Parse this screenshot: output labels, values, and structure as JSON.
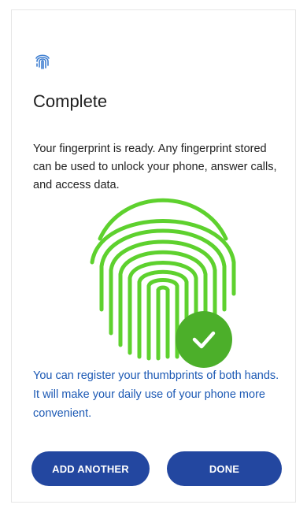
{
  "page": {
    "title": "Complete",
    "description": "Your fingerprint is ready. Any fingerprint stored can be used to unlock your phone, answer calls, and access data.",
    "hint": "You can register your thumbprints of both hands. It will make your daily use of your phone more convenient."
  },
  "icons": {
    "header": "fingerprint-icon",
    "illustration": "fingerprint-illustration",
    "badge": "checkmark-icon"
  },
  "colors": {
    "fingerprint": "#5ed12e",
    "badge": "#4caf2a",
    "hint_text": "#1c59b4",
    "button": "#2347a0"
  },
  "actions": {
    "add_another": "ADD ANOTHER",
    "done": "DONE"
  }
}
